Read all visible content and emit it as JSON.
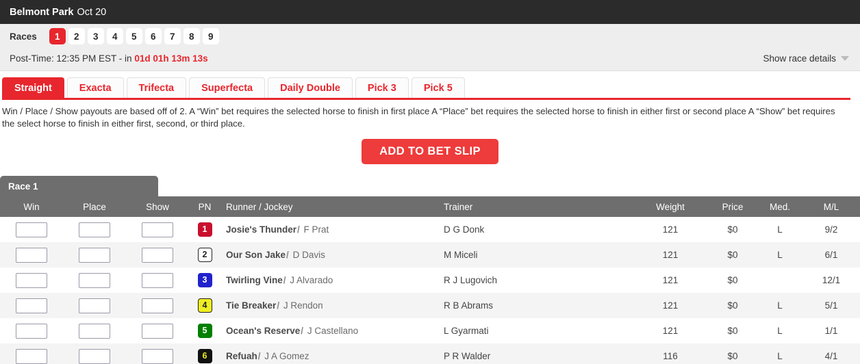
{
  "track": {
    "name": "Belmont Park",
    "date": "Oct 20"
  },
  "races": {
    "label": "Races",
    "numbers": [
      "1",
      "2",
      "3",
      "4",
      "5",
      "6",
      "7",
      "8",
      "9"
    ],
    "active": "1"
  },
  "post_time": {
    "prefix": "Post-Time: 12:35 PM EST - in",
    "countdown": "01d 01h 13m 13s"
  },
  "race_details": {
    "label": "Show race details",
    "icon": "chevron-down-icon"
  },
  "bet_tabs": [
    {
      "label": "Straight",
      "active": true
    },
    {
      "label": "Exacta",
      "active": false
    },
    {
      "label": "Trifecta",
      "active": false
    },
    {
      "label": "Superfecta",
      "active": false
    },
    {
      "label": "Daily Double",
      "active": false
    },
    {
      "label": "Pick 3",
      "active": false
    },
    {
      "label": "Pick 5",
      "active": false
    }
  ],
  "bet_description": "Win / Place / Show payouts are based off of 2. A “Win” bet requires the selected horse to finish in first place A “Place” bet requires the selected horse to finish in either first or second place A “Show” bet requires the select horse to finish in either first, second, or third place.",
  "add_to_bet_slip": "ADD TO BET SLIP",
  "race_table": {
    "tab_label": "Race 1",
    "columns": [
      "Win",
      "Place",
      "Show",
      "PN",
      "Runner / Jockey",
      "Trainer",
      "Weight",
      "Price",
      "Med.",
      "M/L"
    ],
    "input_placeholder": "",
    "rows": [
      {
        "win": "",
        "place": "",
        "show": "",
        "pn": "1",
        "pn_bg": "#c8102e",
        "pn_fg": "#ffffff",
        "pn_border": "#c8102e",
        "runner": "Josie's Thunder",
        "sep": "/",
        "jockey": "F Prat",
        "trainer": "D G Donk",
        "weight": "121",
        "price": "$0",
        "med": "L",
        "ml": "9/2"
      },
      {
        "win": "",
        "place": "",
        "show": "",
        "pn": "2",
        "pn_bg": "#ffffff",
        "pn_fg": "#222222",
        "pn_border": "#222222",
        "runner": "Our Son Jake",
        "sep": "/",
        "jockey": "D Davis",
        "trainer": "M Miceli",
        "weight": "121",
        "price": "$0",
        "med": "L",
        "ml": "6/1"
      },
      {
        "win": "",
        "place": "",
        "show": "",
        "pn": "3",
        "pn_bg": "#2222cc",
        "pn_fg": "#ffffff",
        "pn_border": "#2222cc",
        "runner": "Twirling Vine",
        "sep": "/",
        "jockey": "J Alvarado",
        "trainer": "R J Lugovich",
        "weight": "121",
        "price": "$0",
        "med": "",
        "ml": "12/1"
      },
      {
        "win": "",
        "place": "",
        "show": "",
        "pn": "4",
        "pn_bg": "#eeee22",
        "pn_fg": "#222222",
        "pn_border": "#222222",
        "runner": "Tie Breaker",
        "sep": "/",
        "jockey": "J Rendon",
        "trainer": "R B Abrams",
        "weight": "121",
        "price": "$0",
        "med": "L",
        "ml": "5/1"
      },
      {
        "win": "",
        "place": "",
        "show": "",
        "pn": "5",
        "pn_bg": "#008000",
        "pn_fg": "#ffffff",
        "pn_border": "#008000",
        "runner": "Ocean's Reserve",
        "sep": "/",
        "jockey": "J Castellano",
        "trainer": "L Gyarmati",
        "weight": "121",
        "price": "$0",
        "med": "L",
        "ml": "1/1"
      },
      {
        "win": "",
        "place": "",
        "show": "",
        "pn": "6",
        "pn_bg": "#111111",
        "pn_fg": "#eeee22",
        "pn_border": "#111111",
        "runner": "Refuah",
        "sep": "/",
        "jockey": "J A Gomez",
        "trainer": "P R Walder",
        "weight": "116",
        "price": "$0",
        "med": "L",
        "ml": "4/1"
      }
    ]
  },
  "colors": {
    "brand_red": "#e8262d",
    "button_red": "#ee3b3b",
    "header_dark": "#2b2b2b",
    "table_header_gray": "#6e6e6e"
  }
}
